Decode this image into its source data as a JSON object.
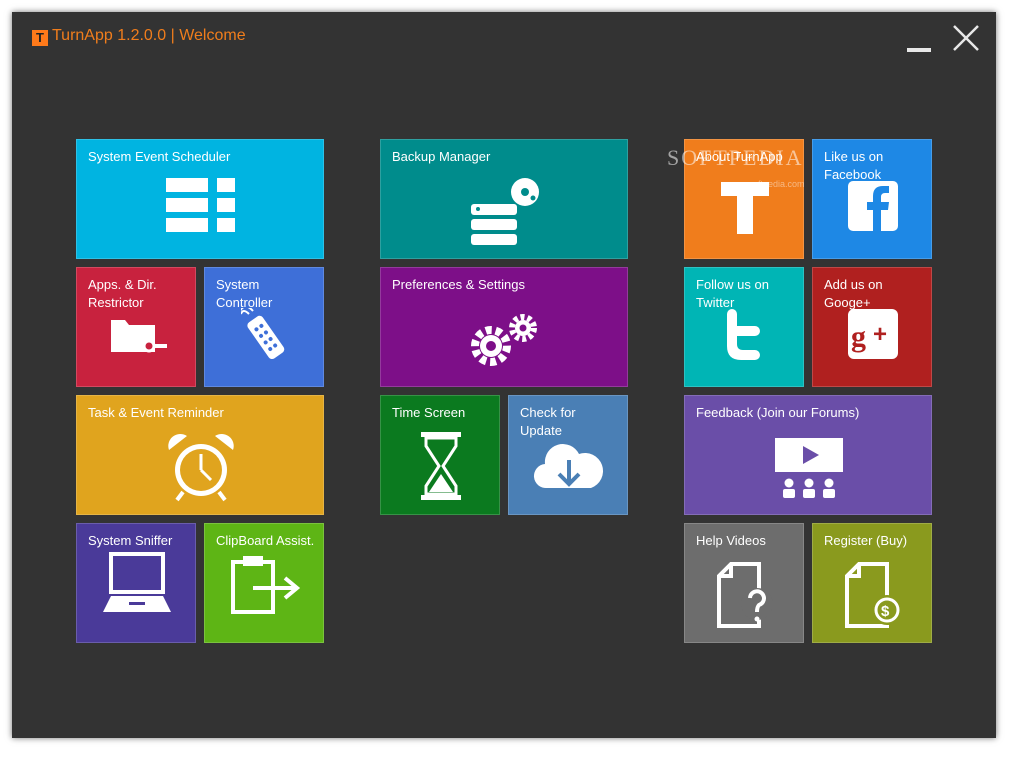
{
  "window": {
    "title": "TurnApp 1.2.0.0 | Welcome",
    "logo_letter": "T",
    "accent_color": "#f07d1c",
    "background_color": "#333333"
  },
  "tiles": {
    "system_event_scheduler": {
      "label": "System Event Scheduler",
      "color": "#00b4e1",
      "icon": "list-icon"
    },
    "apps_dir_restrictor": {
      "label": "Apps. & Dir. Restrictor",
      "color": "#c8223e",
      "icon": "folder-key-icon"
    },
    "system_controller": {
      "label": "System Controller",
      "color": "#3e6fd8",
      "icon": "remote-control-icon"
    },
    "task_event_reminder": {
      "label": "Task & Event Reminder",
      "color": "#e0a41e",
      "icon": "alarm-clock-icon"
    },
    "system_sniffer": {
      "label": "System Sniffer",
      "color": "#4a3a99",
      "icon": "laptop-icon"
    },
    "clipboard_assist": {
      "label": "ClipBoard Assist.",
      "color": "#5eb515",
      "icon": "clipboard-icon"
    },
    "backup_manager": {
      "label": "Backup Manager",
      "color": "#008c8c",
      "icon": "server-disk-icon"
    },
    "preferences_settings": {
      "label": "Preferences & Settings",
      "color": "#7d0f88",
      "icon": "gears-icon"
    },
    "time_screen": {
      "label": "Time Screen",
      "color": "#0b7a1f",
      "icon": "hourglass-icon"
    },
    "check_update": {
      "label": "Check for Update",
      "color": "#4a7fb5",
      "icon": "cloud-download-icon"
    },
    "about_turnapp": {
      "label": "About TurnApp",
      "color": "#f07d1c",
      "icon": "turnapp-logo-icon"
    },
    "facebook": {
      "label": "Like us on Facebook",
      "color": "#1e88e5",
      "icon": "facebook-icon"
    },
    "twitter": {
      "label": "Follow us on Twitter",
      "color": "#00b5b5",
      "icon": "twitter-icon"
    },
    "google_plus": {
      "label": "Add us on Googe+",
      "color": "#b0201f",
      "icon": "google-plus-icon"
    },
    "feedback": {
      "label": "Feedback (Join our Forums)",
      "color": "#6a4ea8",
      "icon": "presentation-icon"
    },
    "help_videos": {
      "label": "Help Videos",
      "color": "#6d6d6d",
      "icon": "help-document-icon"
    },
    "register_buy": {
      "label": "Register (Buy)",
      "color": "#8a9a1e",
      "icon": "purchase-document-icon"
    }
  },
  "watermark": {
    "text": "SOFTPEDIA",
    "sub": "www.softpedia.com"
  }
}
